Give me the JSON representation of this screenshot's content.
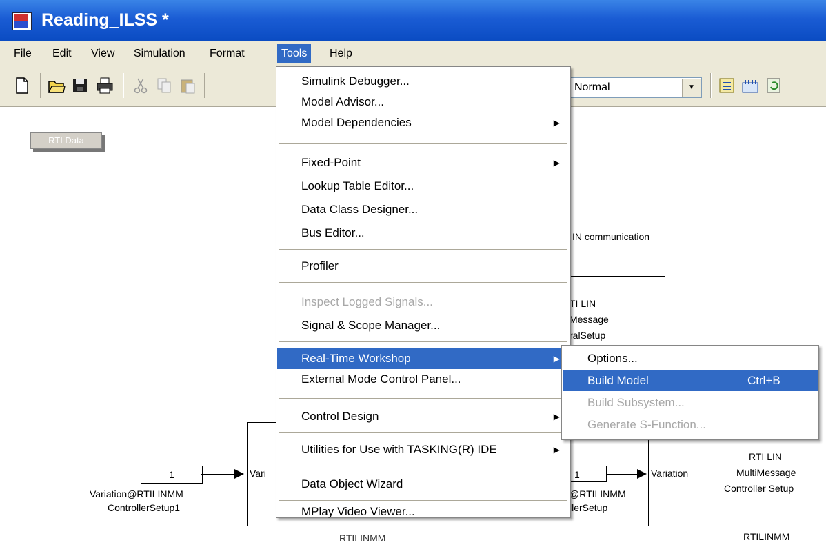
{
  "window": {
    "title": "Reading_ILSS *"
  },
  "menubar": {
    "items": [
      {
        "label": "File"
      },
      {
        "label": "Edit"
      },
      {
        "label": "View"
      },
      {
        "label": "Simulation"
      },
      {
        "label": "Format"
      },
      {
        "label": "Tools"
      },
      {
        "label": "Help"
      }
    ]
  },
  "toolbar": {
    "icons": [
      "new-file-icon",
      "open-folder-icon",
      "save-icon",
      "print-icon",
      "cut-icon",
      "copy-icon",
      "paste-icon"
    ],
    "right_icons": [
      "model-explorer-icon",
      "library-browser-icon",
      "refresh-icon"
    ],
    "mode_select": {
      "value": "Normal"
    }
  },
  "tools_menu": {
    "items": [
      {
        "label": "Simulink Debugger..."
      },
      {
        "label": "Model Advisor..."
      },
      {
        "label": "Model Dependencies"
      },
      {
        "label": "Fixed-Point"
      },
      {
        "label": "Lookup Table Editor..."
      },
      {
        "label": "Data Class Designer..."
      },
      {
        "label": "Bus Editor..."
      },
      {
        "label": "Profiler"
      },
      {
        "label": "Inspect Logged Signals..."
      },
      {
        "label": "Signal & Scope Manager..."
      },
      {
        "label": "Real-Time Workshop"
      },
      {
        "label": "External Mode Control Panel..."
      },
      {
        "label": "Control Design"
      },
      {
        "label": "Utilities for Use with TASKING(R) IDE"
      },
      {
        "label": "Data Object Wizard"
      },
      {
        "label": "MPlay Video Viewer..."
      }
    ]
  },
  "rtw_submenu": {
    "items": [
      {
        "label": "Options...",
        "shortcut": ""
      },
      {
        "label": "Build Model",
        "shortcut": "Ctrl+B"
      },
      {
        "label": "Build Subsystem...",
        "shortcut": ""
      },
      {
        "label": "Generate S-Function...",
        "shortcut": ""
      }
    ]
  },
  "diagram": {
    "rti_data": "RTI Data",
    "lin_comm_label": "IN communication",
    "general_setup_lines": [
      "TI LIN",
      "Message",
      "ralSetup"
    ],
    "const_left": "1",
    "const_left_label": [
      "Variation@RTILINMM",
      "ControllerSetup1"
    ],
    "vari_port": "Vari",
    "bottom_cut": "RTILINMM",
    "const_right": "1",
    "const_right_label": [
      "@RTILINMM",
      "llerSetup"
    ],
    "variation_port": "Variation",
    "mm_block_lines": [
      "RTI LIN",
      "MultiMessage",
      "Controller Setup"
    ],
    "mm_block_name": "RTILINMM"
  }
}
